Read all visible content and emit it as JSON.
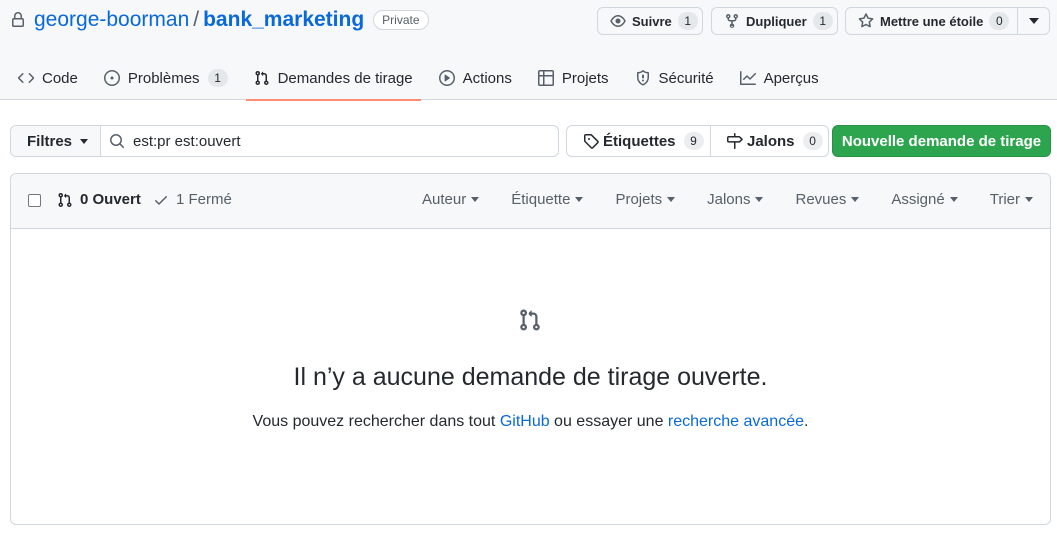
{
  "repo": {
    "owner": "george-boorman",
    "separator": "/",
    "name": "bank_marketing",
    "visibility": "Private"
  },
  "actions": {
    "watch": {
      "label": "Suivre",
      "count": "1"
    },
    "fork": {
      "label": "Dupliquer",
      "count": "1"
    },
    "star": {
      "label": "Mettre une étoile",
      "count": "0"
    }
  },
  "tabs": [
    {
      "label": "Code",
      "icon": "code-icon"
    },
    {
      "label": "Problèmes",
      "icon": "issue-opened-icon",
      "count": "1"
    },
    {
      "label": "Demandes de tirage",
      "icon": "git-pull-request-icon",
      "selected": true
    },
    {
      "label": "Actions",
      "icon": "play-icon"
    },
    {
      "label": "Projets",
      "icon": "table-icon"
    },
    {
      "label": "Sécurité",
      "icon": "shield-icon"
    },
    {
      "label": "Aperçus",
      "icon": "graph-icon"
    }
  ],
  "subnav": {
    "filters_label": "Filtres",
    "search_value": "est:pr est:ouvert",
    "labels": {
      "label": "Étiquettes",
      "count": "9"
    },
    "milestones": {
      "label": "Jalons",
      "count": "0"
    },
    "new_pr_label": "Nouvelle demande de tirage"
  },
  "list_header": {
    "open_label": "0 Ouvert",
    "closed_label": "1 Fermé",
    "filters": [
      "Auteur",
      "Étiquette",
      "Projets",
      "Jalons",
      "Revues",
      "Assigné",
      "Trier"
    ]
  },
  "blankslate": {
    "title": "Il n’y a aucune demande de tirage ouverte.",
    "text_before": "Vous pouvez rechercher dans tout ",
    "link_github": "GitHub",
    "text_middle": " ou essayer une ",
    "link_advanced": "recherche avancée",
    "text_after": "."
  },
  "colors": {
    "link": "#0969da",
    "primary_button": "#2da44e",
    "tab_underline": "#fd8c73",
    "border": "#d0d7de"
  }
}
